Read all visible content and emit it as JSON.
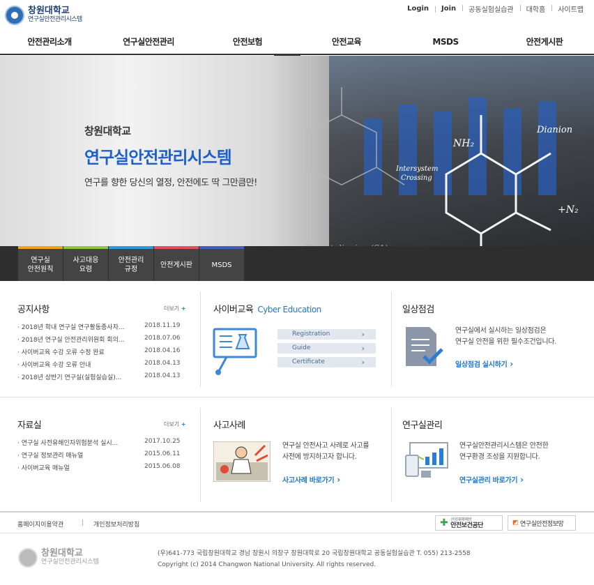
{
  "header": {
    "logo_title": "창원대학교",
    "logo_subtitle": "연구실안전관리시스템",
    "util_links": [
      "Login",
      "Join",
      "공동실험실습관",
      "대학홈",
      "사이트맵"
    ]
  },
  "gnb": {
    "items": [
      "안전관리소개",
      "연구실안전관리",
      "안전보험",
      "안전교육",
      "MSDS",
      "안전게시판"
    ],
    "toggle_icon": "⌄"
  },
  "visual": {
    "subtitle": "창원대학교",
    "title": "연구실안전관리시스템",
    "description": "연구를 향한 당신의 열정, 안전에도 딱 그만큼만!"
  },
  "quick_tabs": [
    {
      "label": "연구실\n안전원칙",
      "color": "#f0a11e"
    },
    {
      "label": "사고대응\n요령",
      "color": "#8dc641"
    },
    {
      "label": "안전관리\n규정",
      "color": "#2a9bd6"
    },
    {
      "label": "안전게시판",
      "color": "#e0505a"
    },
    {
      "label": "MSDS",
      "color": "#3f5fb8"
    }
  ],
  "notice": {
    "title": "공지사항",
    "more": "더보기",
    "items": [
      {
        "text": "· 2018년 학내 연구실 연구활동종사자...",
        "date": "2018.11.19"
      },
      {
        "text": "· 2018년 연구실 안전관리위원회 회의...",
        "date": "2018.07.06"
      },
      {
        "text": "· 사이버교육 수강 오류 수정 완료",
        "date": "2018.04.16"
      },
      {
        "text": "· 사이버교육 수강 오류 안내",
        "date": "2018.04.13"
      },
      {
        "text": "· 2018년 상반기 연구실(실험실습실)...",
        "date": "2018.04.13"
      }
    ]
  },
  "cyber": {
    "title": "사이버교육",
    "title_en": "Cyber Education",
    "buttons": [
      "Registration",
      "Guide",
      "Certificate"
    ]
  },
  "daily": {
    "title": "일상점검",
    "text": "연구실에서 실시하는 일상점검은\n연구실 안전을 위한 필수조건입니다.",
    "link": "일상점검 실시하기"
  },
  "resources": {
    "title": "자료실",
    "more": "더보기",
    "items": [
      {
        "text": "· 연구실 사전유해인자위험분석 실시...",
        "date": "2017.10.25"
      },
      {
        "text": "· 연구실 정보관리 매뉴얼",
        "date": "2015.06.11"
      },
      {
        "text": "· 사이버교육 매뉴얼",
        "date": "2015.06.08"
      }
    ]
  },
  "accident": {
    "title": "사고사례",
    "text": "연구실 안전사고 사례로 사고를\n사전에 방지하고자 합니다.",
    "link": "사고사례 바로가기"
  },
  "labmgmt": {
    "title": "연구실관리",
    "text": "연구실안전관리시스템은 안전한\n연구환경 조성을 지원합니다.",
    "link": "연구실관리 바로가기"
  },
  "footer": {
    "links": [
      "홈페이지이용약관",
      "개인정보처리방침"
    ],
    "partners": [
      "안전보건공단",
      "연구실안전정보망"
    ],
    "partner1_small": "산업재해예방",
    "logo_title": "창원대학교",
    "logo_subtitle": "연구실안전관리시스템",
    "address": "(우)641-773 국립창원대학교 경남 창원시 의창구 창원대학로 20 국립창원대학교 공동실험실습관 T. 055) 213-2558",
    "copyright": "Copyright (c) 2014 Changwon National University. All rights reserved."
  }
}
